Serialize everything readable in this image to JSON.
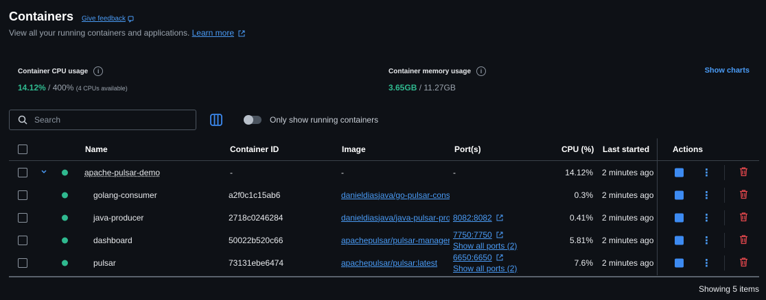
{
  "header": {
    "title": "Containers",
    "feedback": "Give feedback",
    "subtitle": "View all your running containers and applications.",
    "learn_more": "Learn more"
  },
  "stats": {
    "cpu_label": "Container CPU usage",
    "cpu_value": "14.12%",
    "cpu_rest": " / 400%",
    "cpu_note": "(4 CPUs available)",
    "mem_label": "Container memory usage",
    "mem_value": "3.65GB",
    "mem_rest": " / 11.27GB",
    "show_charts": "Show charts"
  },
  "toolbar": {
    "search_placeholder": "Search",
    "toggle_label": "Only show running containers"
  },
  "table": {
    "columns": {
      "name": "Name",
      "container_id": "Container ID",
      "image": "Image",
      "ports": "Port(s)",
      "cpu": "CPU (%)",
      "last_started": "Last started",
      "actions": "Actions"
    },
    "group": {
      "name": "apache-pulsar-demo",
      "container_id": "-",
      "image": "-",
      "ports": "-",
      "cpu": "14.12%",
      "last_started": "2 minutes ago"
    },
    "rows": [
      {
        "name": "golang-consumer",
        "container_id": "a2f0c1c15ab6",
        "image": "danieldiasjava/go-pulsar-consumer",
        "port": "",
        "port_more": "",
        "cpu": "0.3%",
        "last_started": "2 minutes ago"
      },
      {
        "name": "java-producer",
        "container_id": "2718c0246284",
        "image": "danieldiasjava/java-pulsar-producer",
        "port": "8082:8082",
        "port_more": "",
        "cpu": "0.41%",
        "last_started": "2 minutes ago"
      },
      {
        "name": "dashboard",
        "container_id": "50022b520c66",
        "image": "apachepulsar/pulsar-manager",
        "port": "7750:7750",
        "port_more": "Show all ports (2)",
        "cpu": "5.81%",
        "last_started": "2 minutes ago"
      },
      {
        "name": "pulsar",
        "container_id": "73131ebe6474",
        "image": "apachepulsar/pulsar:latest",
        "port": "6650:6650",
        "port_more": "Show all ports (2)",
        "cpu": "7.6%",
        "last_started": "2 minutes ago"
      }
    ],
    "footer": "Showing 5 items"
  },
  "colors": {
    "background": "#0e1116",
    "accent": "#4a9bf5",
    "running": "#2fb98f",
    "danger": "#e5484d"
  }
}
